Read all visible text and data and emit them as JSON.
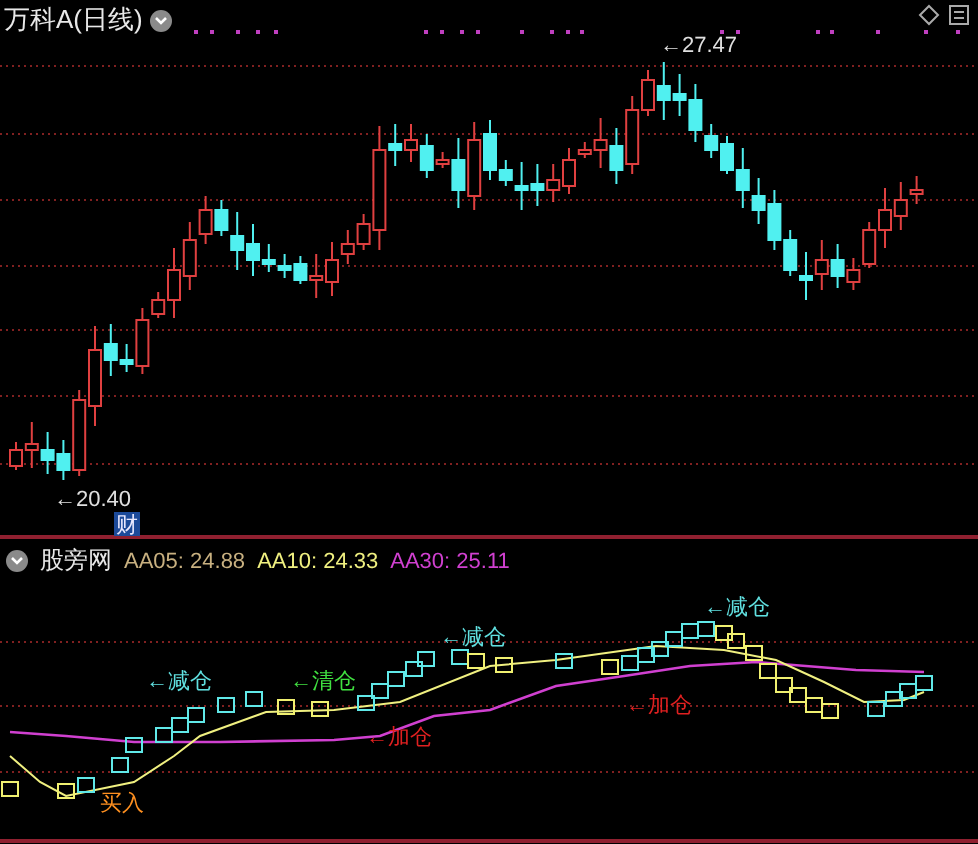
{
  "header": {
    "title": "万科A(日线)"
  },
  "price_marks": [
    {
      "text": "←27.47"
    },
    {
      "text": "←20.40"
    }
  ],
  "badge": {
    "text": "财"
  },
  "indicator": {
    "name": "股旁网",
    "values": [
      {
        "label": "AA05: 24.88",
        "color": "#c8b080"
      },
      {
        "label": "AA10: 24.33",
        "color": "#f0f080"
      },
      {
        "label": "AA30: 25.11",
        "color": "#d040d0"
      }
    ]
  },
  "signals": [
    {
      "text": "←减仓",
      "color": "#60e0e0"
    },
    {
      "text": "←清仓",
      "color": "#40e040"
    },
    {
      "text": "←减仓",
      "color": "#60e0e0"
    },
    {
      "text": "←减仓",
      "color": "#60e0e0"
    },
    {
      "text": "←加仓",
      "color": "#e02020"
    },
    {
      "text": "←加仓",
      "color": "#e02020"
    },
    {
      "text": "买入",
      "color": "#ff9020"
    }
  ]
}
